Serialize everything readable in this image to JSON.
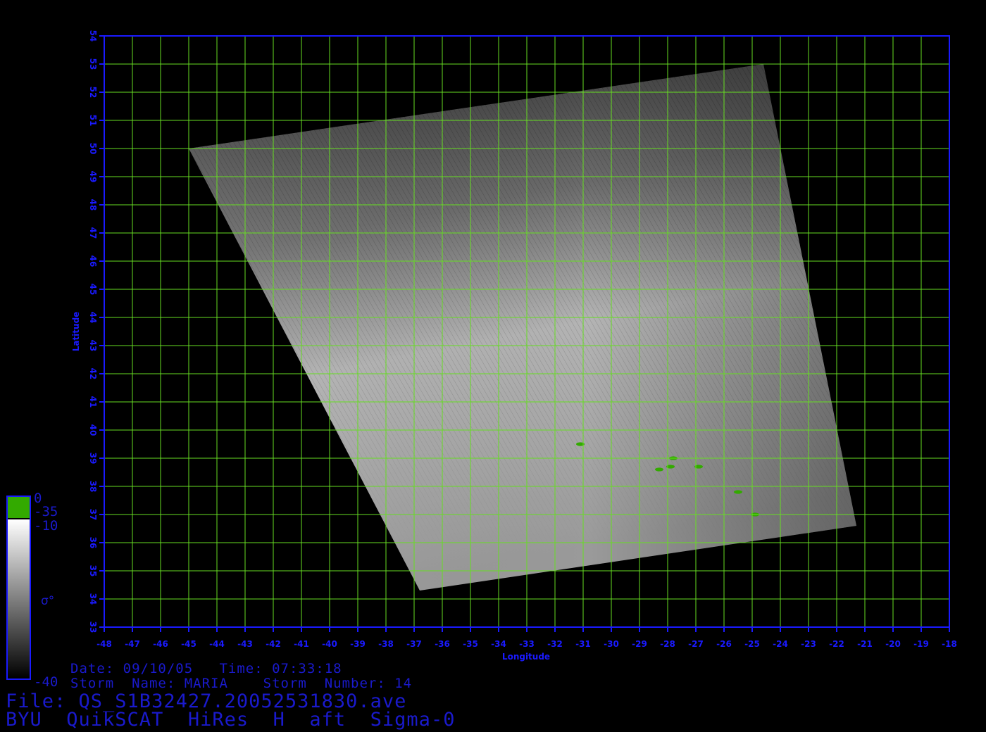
{
  "map": {
    "xaxis": {
      "label": "Longitude",
      "min": -48,
      "max": -18,
      "step": 1,
      "tick_labels": [
        "-48",
        "-47",
        "-46",
        "-45",
        "-44",
        "-43",
        "-42",
        "-41",
        "-40",
        "-39",
        "-38",
        "-37",
        "-36",
        "-35",
        "-34",
        "-33",
        "-32",
        "-31",
        "-30",
        "-29",
        "-28",
        "-27",
        "-26",
        "-25",
        "-24",
        "-23",
        "-22",
        "-21",
        "-20",
        "-19",
        "-18"
      ]
    },
    "yaxis": {
      "label": "Latitude",
      "min": 33,
      "max": 54,
      "step": 1,
      "tick_labels": [
        "33",
        "34",
        "35",
        "36",
        "37",
        "38",
        "39",
        "40",
        "41",
        "42",
        "43",
        "44",
        "45",
        "46",
        "47",
        "48",
        "49",
        "50",
        "51",
        "52",
        "53",
        "54"
      ]
    },
    "grid": true,
    "grid_color": "#66dd22",
    "axis_color": "#1a1aff",
    "swath_corners_lonlat": [
      [
        -45,
        50
      ],
      [
        -24.6,
        53
      ],
      [
        -21.3,
        36.6
      ],
      [
        -36.8,
        34.3
      ]
    ],
    "islands_lonlat": [
      [
        -31.1,
        39.5
      ],
      [
        -28.3,
        38.6
      ],
      [
        -27.9,
        38.7
      ],
      [
        -27.8,
        39.0
      ],
      [
        -26.9,
        38.7
      ],
      [
        -25.5,
        37.8
      ],
      [
        -24.9,
        37.0
      ]
    ],
    "land_color": "#33aa00"
  },
  "colorbar": {
    "label": "σ°",
    "tick_labels": [
      "0",
      "-35",
      "-10",
      "-40"
    ],
    "land_color": "#33aa00"
  },
  "info": {
    "date_time": "Date: 09/10/05   Time: 07:33:18",
    "storm": "Storm  Name: MARIA    Storm  Number: 14",
    "file": "File: QS_S1B32427.20052531830.ave",
    "product": "BYU  QuikSCAT  HiRes  H  aft  Sigma-0"
  }
}
